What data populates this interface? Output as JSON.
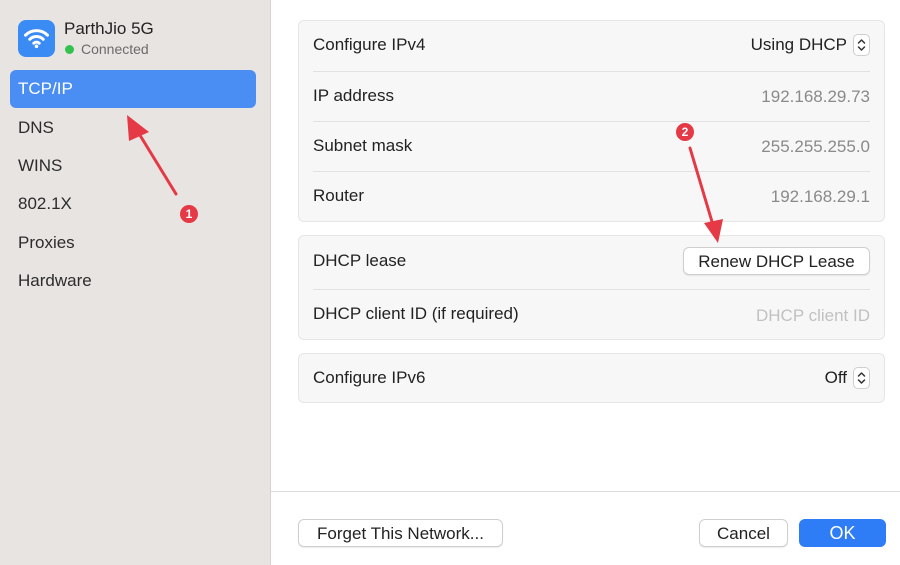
{
  "network": {
    "name": "ParthJio 5G",
    "status": "Connected"
  },
  "sidebar": {
    "items": [
      {
        "label": "TCP/IP",
        "selected": true
      },
      {
        "label": "DNS"
      },
      {
        "label": "WINS"
      },
      {
        "label": "802.1X"
      },
      {
        "label": "Proxies"
      },
      {
        "label": "Hardware"
      }
    ]
  },
  "ipv4": {
    "configure_label": "Configure IPv4",
    "configure_value": "Using DHCP",
    "ip_label": "IP address",
    "ip_value": "192.168.29.73",
    "subnet_label": "Subnet mask",
    "subnet_value": "255.255.255.0",
    "router_label": "Router",
    "router_value": "192.168.29.1"
  },
  "dhcp": {
    "lease_label": "DHCP lease",
    "renew_button": "Renew DHCP Lease",
    "client_id_label": "DHCP client ID (if required)",
    "client_id_placeholder": "DHCP client ID",
    "client_id_value": ""
  },
  "ipv6": {
    "configure_label": "Configure IPv6",
    "configure_value": "Off"
  },
  "footer": {
    "forget_button": "Forget This Network...",
    "cancel_button": "Cancel",
    "ok_button": "OK"
  },
  "annotations": {
    "marker1": "1",
    "marker2": "2"
  },
  "colors": {
    "accent": "#4b8ef3",
    "ok_button": "#2e7cf6",
    "annotation_red": "#e53945",
    "status_green": "#33c24d"
  }
}
